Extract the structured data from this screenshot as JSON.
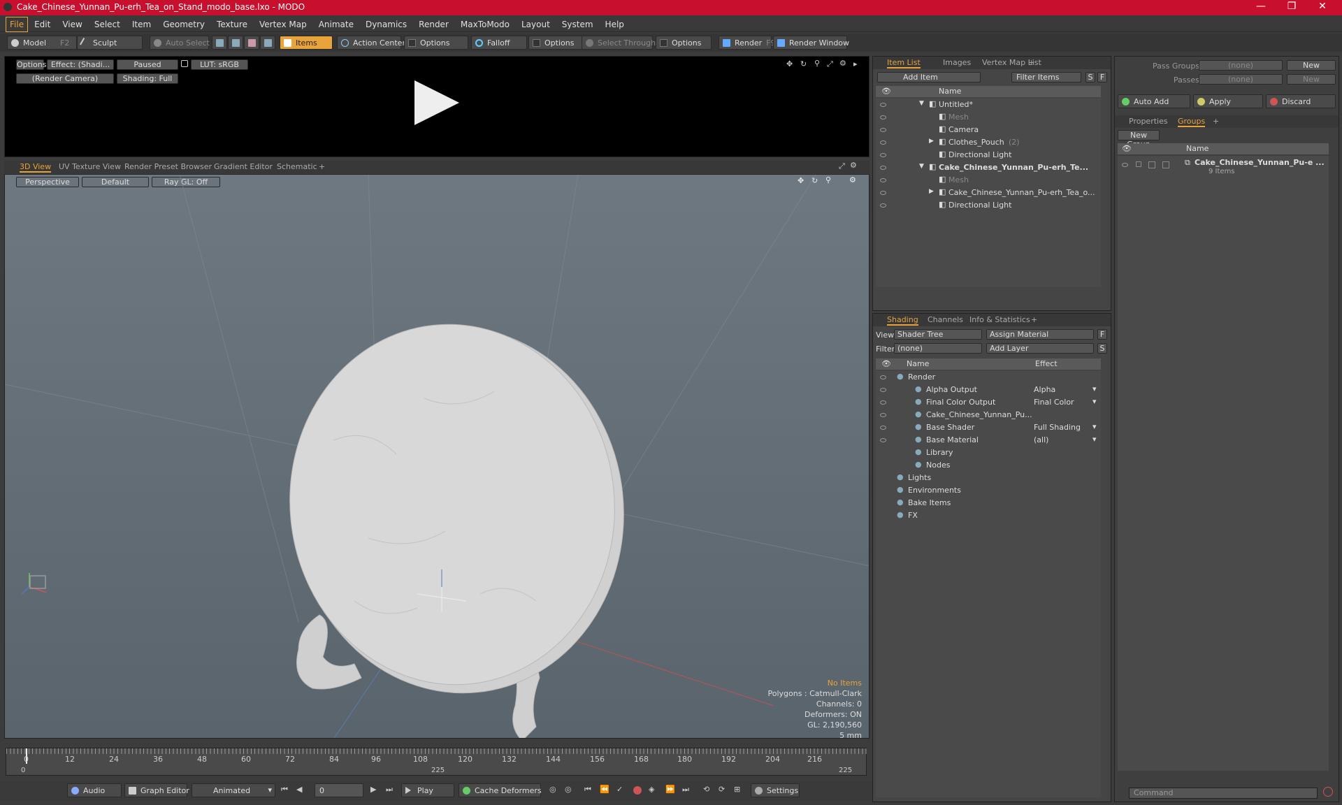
{
  "window": {
    "title": "Cake_Chinese_Yunnan_Pu-erh_Tea_on_Stand_modo_base.lxo - MODO"
  },
  "menu": [
    "File",
    "Edit",
    "View",
    "Select",
    "Item",
    "Geometry",
    "Texture",
    "Vertex Map",
    "Animate",
    "Dynamics",
    "Render",
    "MaxToModo",
    "Layout",
    "System",
    "Help"
  ],
  "toolbar": {
    "model": "Model",
    "model_key": "F2",
    "sculpt": "Sculpt",
    "auto_select": "Auto Select",
    "items": "Items",
    "action_center": "Action Center",
    "options1": "Options",
    "falloff": "Falloff",
    "options2": "Options",
    "select_through": "Select Through",
    "options3": "Options",
    "render": "Render",
    "render_key": "F9",
    "render_window": "Render Window"
  },
  "preview": {
    "options": "Options",
    "effect": "Effect: (Shadi...",
    "paused": "Paused",
    "lut": "LUT: sRGB",
    "camera": "(Render Camera)",
    "shading": "Shading: Full"
  },
  "viewport": {
    "tabs": [
      "3D View",
      "UV Texture View",
      "Render Preset Browser",
      "Gradient Editor",
      "Schematic",
      "+"
    ],
    "perspective": "Perspective",
    "default": "Default",
    "raygl": "Ray GL: Off",
    "info": {
      "no_items": "No Items",
      "polygons": "Polygons : Catmull-Clark",
      "channels": "Channels: 0",
      "deformers": "Deformers: ON",
      "gl": "GL: 2,190,560",
      "size": "5 mm"
    }
  },
  "timeline": {
    "ticks": [
      "0",
      "12",
      "24",
      "36",
      "48",
      "60",
      "72",
      "84",
      "96",
      "108",
      "120",
      "132",
      "144",
      "156",
      "168",
      "180",
      "192",
      "204",
      "216"
    ],
    "sub": [
      "0",
      "225",
      "225"
    ]
  },
  "bottombar": {
    "audio": "Audio",
    "graph_editor": "Graph Editor",
    "animated": "Animated",
    "frame": "0",
    "play": "Play",
    "cache": "Cache Deformers",
    "settings": "Settings"
  },
  "itemlist": {
    "tabs": [
      "Item List",
      "Images",
      "Vertex Map List",
      "+"
    ],
    "add_item": "Add Item",
    "filter": "Filter Items",
    "s": "S",
    "f": "F",
    "col_name": "Name",
    "rows": [
      {
        "label": "Untitled*",
        "indent": 0,
        "expander": "▼",
        "dim": false,
        "bold": false
      },
      {
        "label": "Mesh",
        "indent": 2,
        "expander": "",
        "dim": true,
        "bold": false
      },
      {
        "label": "Camera",
        "indent": 2,
        "expander": "",
        "dim": false,
        "bold": false
      },
      {
        "label": "Clothes_Pouch",
        "count": "(2)",
        "indent": 2,
        "expander": "▶",
        "dim": false,
        "bold": false
      },
      {
        "label": "Directional Light",
        "indent": 2,
        "expander": "",
        "dim": false,
        "bold": false
      },
      {
        "label": "Cake_Chinese_Yunnan_Pu-erh_Te...",
        "indent": 0,
        "expander": "▼",
        "dim": false,
        "bold": true
      },
      {
        "label": "Mesh",
        "indent": 2,
        "expander": "",
        "dim": true,
        "bold": false
      },
      {
        "label": "Cake_Chinese_Yunnan_Pu-erh_Tea_o...",
        "indent": 2,
        "expander": "▶",
        "dim": false,
        "bold": false
      },
      {
        "label": "Directional Light",
        "indent": 2,
        "expander": "",
        "dim": false,
        "bold": false
      }
    ]
  },
  "shading": {
    "tabs": [
      "Shading",
      "Channels",
      "Info & Statistics",
      "+"
    ],
    "view_label": "View",
    "view_value": "Shader Tree",
    "assign": "Assign Material",
    "f": "F",
    "filter_label": "Filter",
    "filter_value": "(none)",
    "add_layer": "Add Layer",
    "s": "S",
    "col_name": "Name",
    "col_effect": "Effect",
    "rows": [
      {
        "label": "Render",
        "effect": "",
        "indent": 0
      },
      {
        "label": "Alpha Output",
        "effect": "Alpha",
        "indent": 1
      },
      {
        "label": "Final Color Output",
        "effect": "Final Color",
        "indent": 1
      },
      {
        "label": "Cake_Chinese_Yunnan_Pu...",
        "effect": "",
        "indent": 1
      },
      {
        "label": "Base Shader",
        "effect": "Full Shading",
        "indent": 1
      },
      {
        "label": "Base Material",
        "effect": "(all)",
        "indent": 1
      },
      {
        "label": "Library",
        "effect": "",
        "indent": 1
      },
      {
        "label": "Nodes",
        "effect": "",
        "indent": 1
      },
      {
        "label": "Lights",
        "effect": "",
        "indent": 0
      },
      {
        "label": "Environments",
        "effect": "",
        "indent": 0
      },
      {
        "label": "Bake Items",
        "effect": "",
        "indent": 0
      },
      {
        "label": "FX",
        "effect": "",
        "indent": 0
      }
    ]
  },
  "groups": {
    "pass_groups": "Pass Groups",
    "pass_groups_value": "(none)",
    "new": "New",
    "passes": "Passes",
    "passes_value": "(none)",
    "new2": "New",
    "auto_add": "Auto Add",
    "apply": "Apply",
    "discard": "Discard",
    "tabs": [
      "Properties",
      "Groups",
      "+"
    ],
    "new_group": "New Group",
    "col_name": "Name",
    "item_label": "Cake_Chinese_Yunnan_Pu-e ...",
    "item_sub": "9 Items"
  },
  "command": {
    "placeholder": "Command"
  }
}
